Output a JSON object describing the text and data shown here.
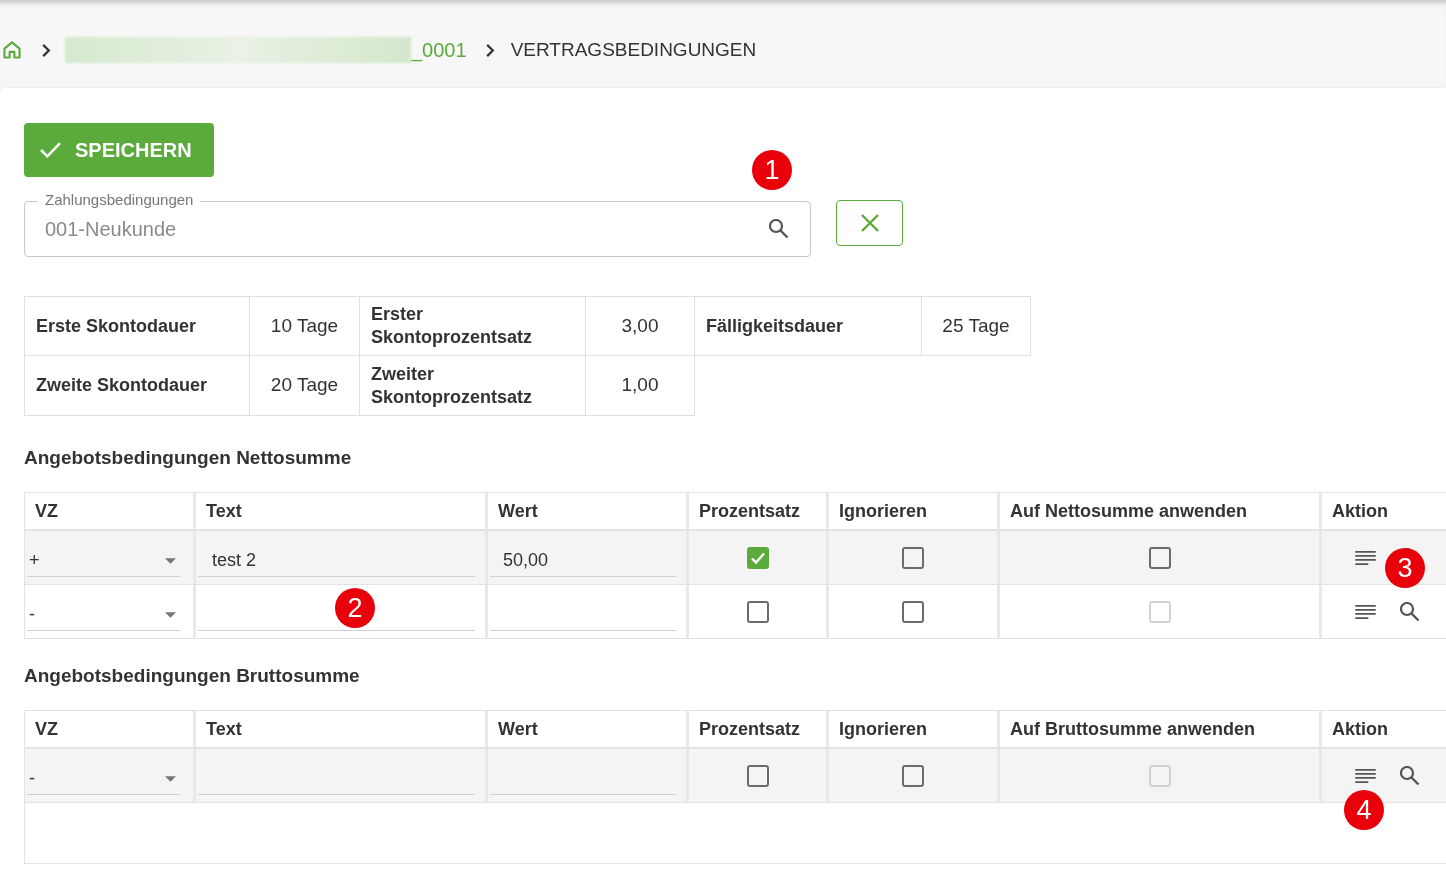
{
  "breadcrumb": {
    "link": {
      "text": "_0001",
      "redacted": true
    },
    "current": "VERTRAGSBEDINGUNGEN"
  },
  "save_button": {
    "label": "SPEICHERN"
  },
  "payment_terms": {
    "label": "Zahlungsbedingungen",
    "value": "001-Neukunde"
  },
  "discount_terms": {
    "rows": [
      {
        "cells": [
          {
            "label": "Erste Skontodauer",
            "value": "10 Tage"
          },
          {
            "label": "Erster Skontoprozentsatz",
            "value": "3,00"
          },
          {
            "label": "Fälligkeitsdauer",
            "value": "25 Tage"
          }
        ]
      },
      {
        "cells": [
          {
            "label": "Zweite Skontodauer",
            "value": "20 Tage"
          },
          {
            "label": "Zweiter Skontoprozentsatz",
            "value": "1,00"
          }
        ]
      }
    ]
  },
  "net_conditions": {
    "title": "Angebotsbedingungen Nettosumme",
    "columns": [
      "VZ",
      "Text",
      "Wert",
      "Prozentsatz",
      "Ignorieren",
      "Auf Nettosumme anwenden",
      "Aktion"
    ],
    "rows": [
      {
        "sign": "+",
        "text": "test 2",
        "value": "50,00",
        "percentage_checked": true,
        "ignore_checked": false,
        "apply_checked": false,
        "apply_disabled": false
      },
      {
        "sign": "-",
        "percentage_checked": false,
        "ignore_checked": false,
        "apply_checked": false,
        "apply_disabled": true
      }
    ]
  },
  "gross_conditions": {
    "title": "Angebotsbedingungen Bruttosumme",
    "columns": [
      "VZ",
      "Text",
      "Wert",
      "Prozentsatz",
      "Ignorieren",
      "Auf Bruttosumme anwenden",
      "Aktion"
    ],
    "rows": [
      {
        "sign": "-",
        "percentage_checked": false,
        "ignore_checked": false,
        "apply_checked": false,
        "apply_disabled": true
      }
    ]
  },
  "annotations": [
    {
      "label": "1"
    },
    {
      "label": "2"
    },
    {
      "label": "3"
    },
    {
      "label": "4"
    }
  ]
}
